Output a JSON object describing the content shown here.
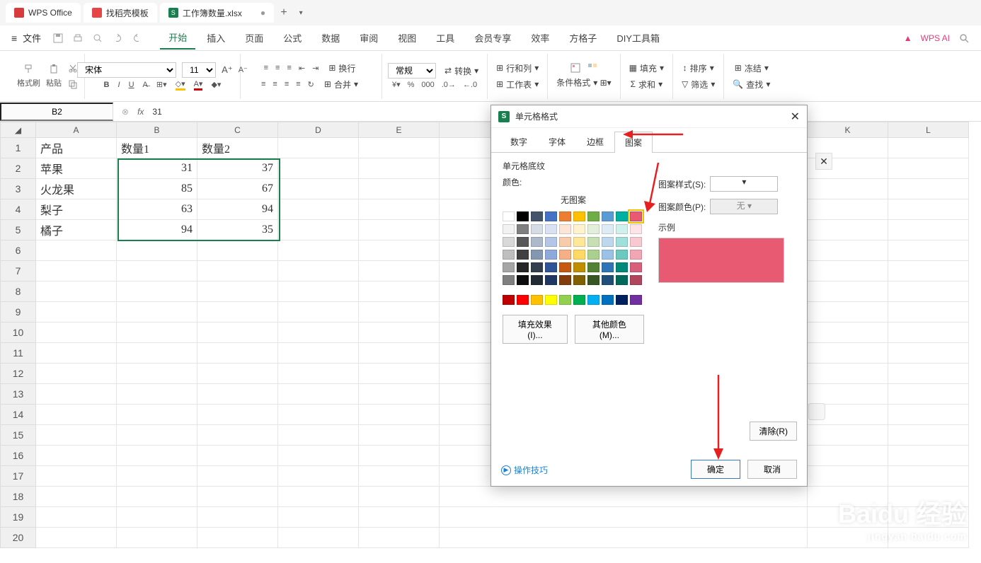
{
  "tabs": {
    "wps": "WPS Office",
    "docer": "找稻壳模板",
    "active": "工作簿数量.xlsx"
  },
  "file_label": "文件",
  "menu": [
    "开始",
    "插入",
    "页面",
    "公式",
    "数据",
    "审阅",
    "视图",
    "工具",
    "会员专享",
    "效率",
    "方格子",
    "DIY工具箱"
  ],
  "menu_active_idx": 0,
  "ai_label": "WPS AI",
  "ribbon": {
    "format_painter": "格式刷",
    "paste": "粘贴",
    "font_name": "宋体",
    "font_size": "11",
    "number": "常规",
    "convert": "转换",
    "rows_cols": "行和列",
    "sheet": "工作表",
    "cond_fmt": "条件格式",
    "fill": "填充",
    "sort": "排序",
    "freeze": "冻结",
    "sum": "求和",
    "filter": "筛选",
    "find": "查找",
    "merge": "合并",
    "wrap": "换行"
  },
  "cell_ref": "B2",
  "formula_value": "31",
  "cols": [
    "A",
    "B",
    "C",
    "D",
    "E",
    "K",
    "L"
  ],
  "rows": [
    1,
    2,
    3,
    4,
    5,
    6,
    7,
    8,
    9,
    10,
    11,
    12,
    13,
    14,
    15,
    16,
    17,
    18,
    19,
    20
  ],
  "data": {
    "A1": "产品",
    "B1": "数量1",
    "C1": "数量2",
    "A2": "苹果",
    "B2": "31",
    "C2": "37",
    "A3": "火龙果",
    "B3": "85",
    "C3": "67",
    "A4": "梨子",
    "B4": "63",
    "C4": "94",
    "A5": "橘子",
    "B5": "94",
    "C5": "35"
  },
  "dialog": {
    "title": "单元格格式",
    "tabs": [
      "数字",
      "字体",
      "边框",
      "图案"
    ],
    "active_tab": 3,
    "section": "单元格底纹",
    "color_label": "颜色:",
    "no_pattern": "无图案",
    "pattern_style": "图案样式(S):",
    "pattern_color": "图案颜色(P):",
    "pattern_color_val": "无",
    "sample": "示例",
    "fill_effect": "填充效果(I)...",
    "more_colors": "其他颜色(M)...",
    "clear": "清除(R)",
    "ok": "确定",
    "cancel": "取消",
    "tips": "操作技巧"
  },
  "colors": {
    "r1": [
      "#ffffff",
      "#000000",
      "#44546a",
      "#4472c4",
      "#ed7d31",
      "#ffc000",
      "#70ad47",
      "#5b9bd5",
      "#00b0a0",
      "#e85a71"
    ],
    "r2": [
      "#f2f2f2",
      "#808080",
      "#d6dce5",
      "#d9e1f2",
      "#fce4d6",
      "#fff2cc",
      "#e2efda",
      "#ddebf7",
      "#d0f0ed",
      "#fce4e8"
    ],
    "r3": [
      "#d9d9d9",
      "#595959",
      "#acb9ca",
      "#b4c6e7",
      "#f8cbad",
      "#ffe699",
      "#c6e0b4",
      "#bdd7ee",
      "#a0e0da",
      "#f8c9d0"
    ],
    "r4": [
      "#bfbfbf",
      "#404040",
      "#8497b0",
      "#8ea9db",
      "#f4b084",
      "#ffd966",
      "#a9d08e",
      "#9bc2e6",
      "#6cc9c0",
      "#f2a6b4"
    ],
    "r5": [
      "#a6a6a6",
      "#262626",
      "#333f4f",
      "#305496",
      "#c65911",
      "#bf8f00",
      "#548235",
      "#2f75b5",
      "#00897a",
      "#d8607a"
    ],
    "r6": [
      "#7f7f7f",
      "#0d0d0d",
      "#222b35",
      "#203764",
      "#833c0c",
      "#806000",
      "#375623",
      "#1f4e78",
      "#00695c",
      "#b0455c"
    ],
    "r7": [
      "#c00000",
      "#ff0000",
      "#ffc000",
      "#ffff00",
      "#92d050",
      "#00b050",
      "#00b0f0",
      "#0070c0",
      "#002060",
      "#7030a0"
    ]
  },
  "watermark": {
    "brand": "Baidu 经验",
    "sub": "jingyan.baidu.com"
  }
}
